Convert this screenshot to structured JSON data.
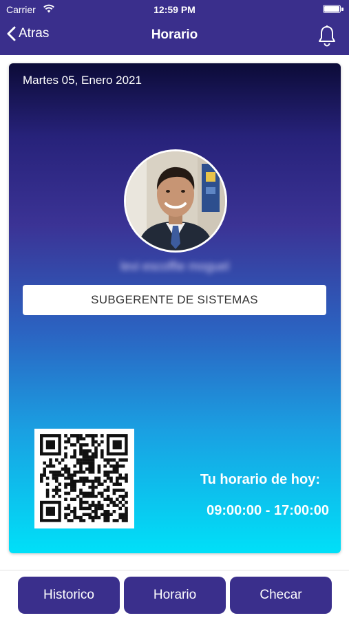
{
  "status_bar": {
    "carrier": "Carrier",
    "time": "12:59 PM"
  },
  "nav": {
    "back_label": "Atras",
    "title": "Horario"
  },
  "card": {
    "date": "Martes 05, Enero 2021",
    "name": "levi escoffie moguel",
    "role": "SUBGERENTE DE SISTEMAS",
    "schedule_label": "Tu horario de hoy:",
    "schedule_value": "09:00:00 - 17:00:00"
  },
  "tabs": [
    {
      "label": "Historico"
    },
    {
      "label": "Horario"
    },
    {
      "label": "Checar"
    }
  ],
  "colors": {
    "primary": "#3a2f8c",
    "gradient_top": "#0c0b38",
    "gradient_bottom": "#00e0f8"
  }
}
